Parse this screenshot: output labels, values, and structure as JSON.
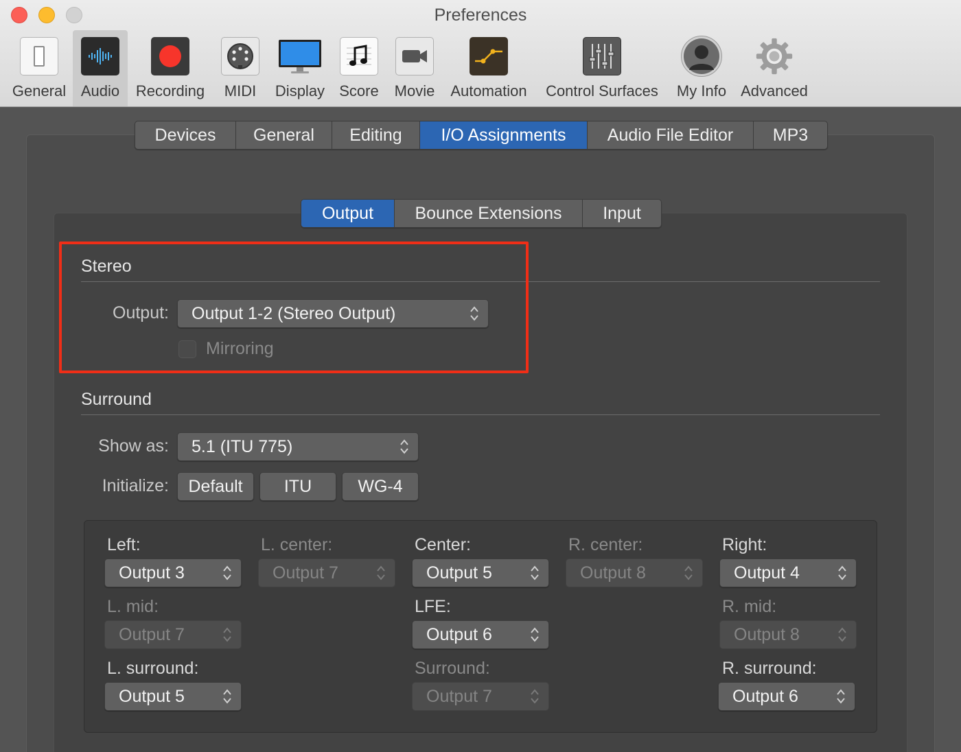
{
  "window": {
    "title": "Preferences"
  },
  "toolbar": {
    "items": [
      {
        "label": "General",
        "icon": "light-switch-icon"
      },
      {
        "label": "Audio",
        "icon": "waveform-icon"
      },
      {
        "label": "Recording",
        "icon": "record-icon"
      },
      {
        "label": "MIDI",
        "icon": "midi-connector-icon"
      },
      {
        "label": "Display",
        "icon": "monitor-icon"
      },
      {
        "label": "Score",
        "icon": "music-note-icon"
      },
      {
        "label": "Movie",
        "icon": "video-camera-icon"
      },
      {
        "label": "Automation",
        "icon": "automation-curve-icon"
      },
      {
        "label": "Control Surfaces",
        "icon": "faders-icon"
      },
      {
        "label": "My Info",
        "icon": "user-silhouette-icon"
      },
      {
        "label": "Advanced",
        "icon": "gear-icon"
      }
    ],
    "selected": "Audio"
  },
  "tabs": {
    "items": [
      "Devices",
      "General",
      "Editing",
      "I/O Assignments",
      "Audio File Editor",
      "MP3"
    ],
    "selected": "I/O Assignments"
  },
  "subtabs": {
    "items": [
      "Output",
      "Bounce Extensions",
      "Input"
    ],
    "selected": "Output"
  },
  "stereo": {
    "title": "Stereo",
    "output_label": "Output:",
    "output_value": "Output 1-2 (Stereo Output)",
    "mirroring_label": "Mirroring",
    "mirroring_checked": false
  },
  "surround": {
    "title": "Surround",
    "show_as_label": "Show as:",
    "show_as_value": "5.1 (ITU 775)",
    "initialize_label": "Initialize:",
    "initialize_buttons": [
      "Default",
      "ITU",
      "WG-4"
    ],
    "channels": {
      "left": {
        "label": "Left:",
        "value": "Output 3",
        "enabled": true
      },
      "l_center": {
        "label": "L. center:",
        "value": "Output 7",
        "enabled": false
      },
      "center": {
        "label": "Center:",
        "value": "Output 5",
        "enabled": true
      },
      "r_center": {
        "label": "R. center:",
        "value": "Output 8",
        "enabled": false
      },
      "right": {
        "label": "Right:",
        "value": "Output 4",
        "enabled": true
      },
      "l_mid": {
        "label": "L. mid:",
        "value": "Output 7",
        "enabled": false
      },
      "lfe": {
        "label": "LFE:",
        "value": "Output 6",
        "enabled": true
      },
      "r_mid": {
        "label": "R. mid:",
        "value": "Output 8",
        "enabled": false
      },
      "l_surround": {
        "label": "L. surround:",
        "value": "Output 5",
        "enabled": true
      },
      "surround": {
        "label": "Surround:",
        "value": "Output 7",
        "enabled": false
      },
      "r_surround": {
        "label": "R. surround:",
        "value": "Output 6",
        "enabled": true
      }
    }
  },
  "colors": {
    "accent": "#2c66b3",
    "highlight": "#f02e17"
  }
}
